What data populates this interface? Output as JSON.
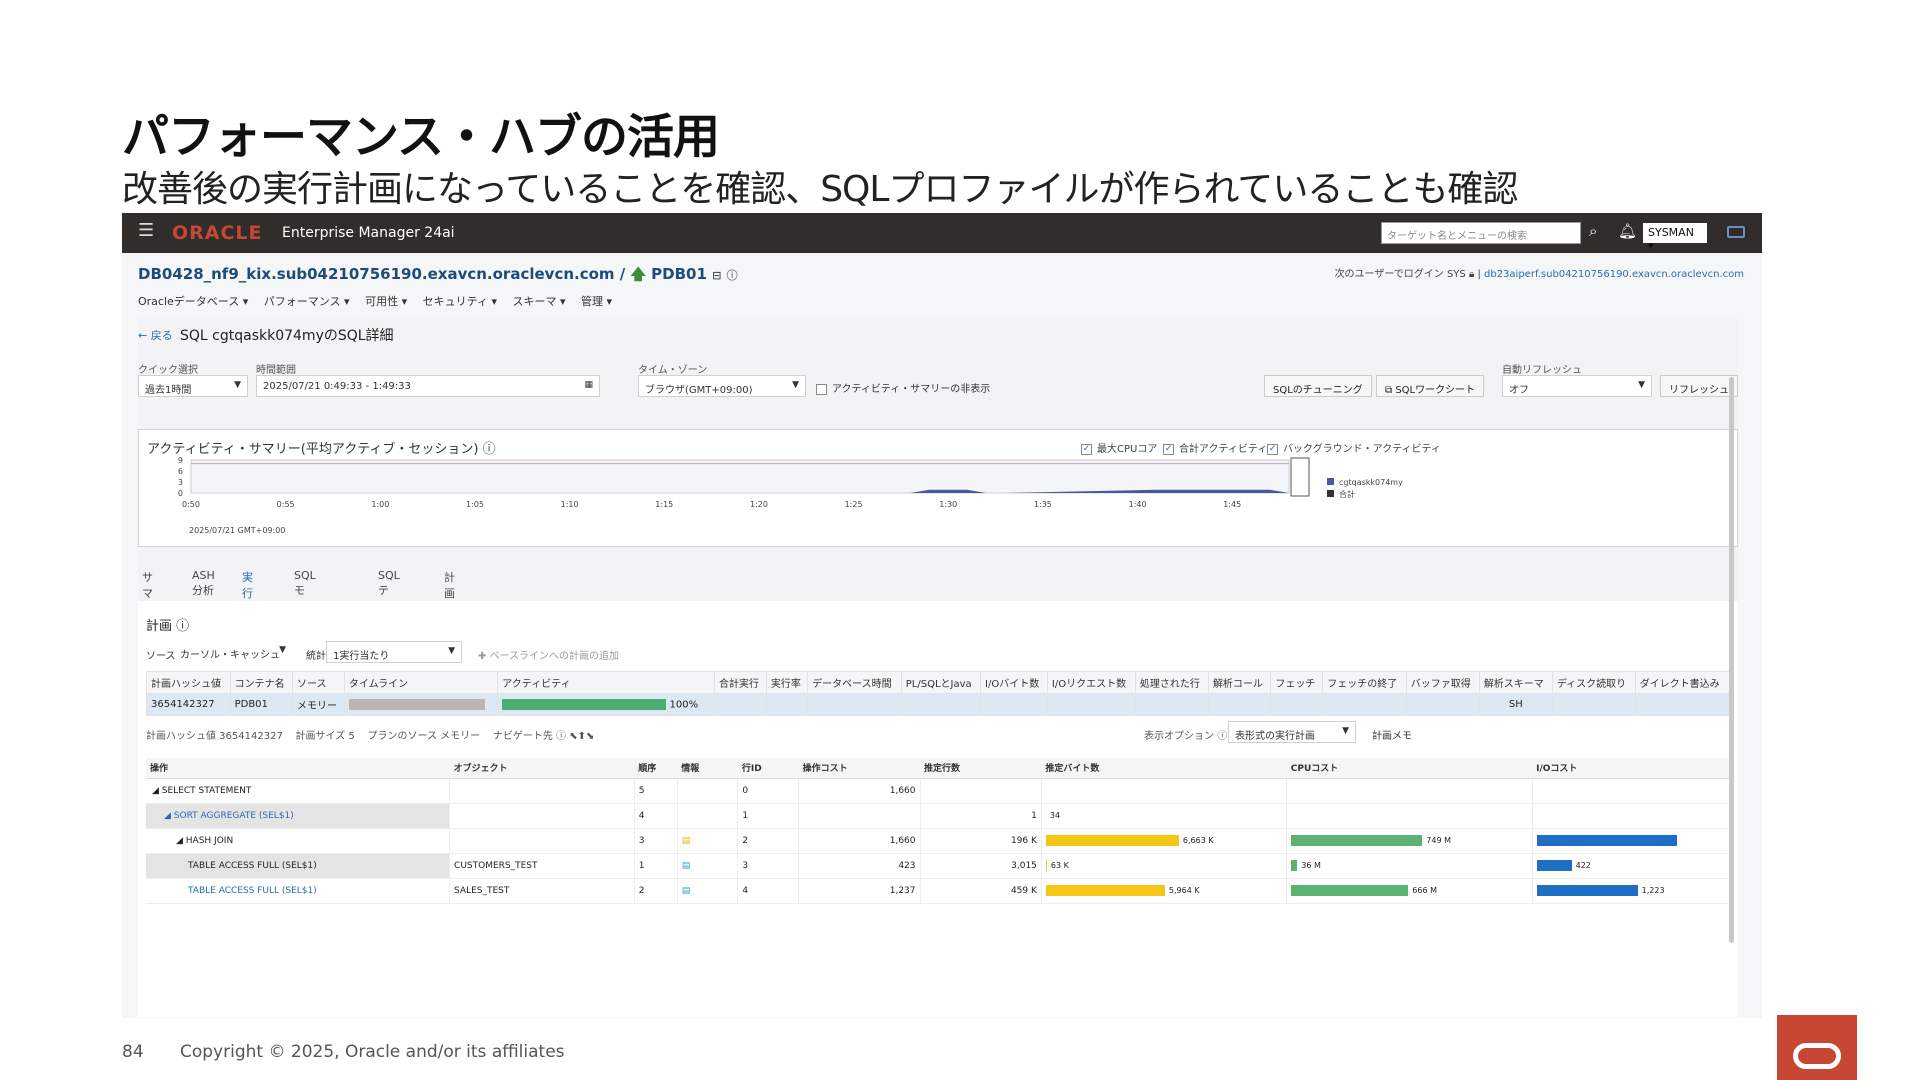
{
  "slide": {
    "title": "パフォーマンス・ハブの活用",
    "subtitle": "改善後の実行計画になっていることを確認、SQLプロファイルが作られていることも確認",
    "page_number": "84",
    "copyright": "Copyright © 2025, Oracle and/or its affiliates"
  },
  "topbar": {
    "brand": "ORACLE",
    "product": "Enterprise Manager 24ai",
    "search_placeholder": "ターゲット名とメニューの検索",
    "user": "SYSMAN"
  },
  "breadcrumb": {
    "db": "DB0428_nf9_kix.sub04210756190.exavcn.oraclevcn.com /",
    "pdb": "PDB01"
  },
  "login": {
    "text": "次のユーザーでログイン SYS",
    "host": "db23aiperf.sub04210756190.exavcn.oraclevcn.com"
  },
  "menu": [
    "Oracleデータベース ▾",
    "パフォーマンス ▾",
    "可用性 ▾",
    "セキュリティ ▾",
    "スキーマ ▾",
    "管理 ▾"
  ],
  "sql_detail": {
    "back": "← 戻る",
    "header": "SQL cgtqaskk074myのSQL詳細",
    "quick_select_label": "クイック選択",
    "quick_select_value": "過去1時間",
    "time_range_label": "時間範囲",
    "time_range_value": "2025/07/21 0:49:33 - 1:49:33",
    "timezone_label": "タイム・ゾーン",
    "timezone_value": "ブラウザ(GMT+09:00)",
    "hide_summary": "アクティビティ・サマリーの非表示",
    "sql_tuning": "SQLのチューニング",
    "sql_worksheet": "SQLワークシート",
    "auto_refresh_label": "自動リフレッシュ",
    "auto_refresh_value": "オフ",
    "refresh": "リフレッシュ"
  },
  "activity": {
    "title": "アクティビティ・サマリー(平均アクティブ・セッション)",
    "check_max_cpu": "最大CPUコア",
    "check_total": "合計アクティビティ",
    "check_background": "バックグラウンド・アクティビティ",
    "date_label": "2025/07/21 GMT+09:00"
  },
  "chart_data": {
    "type": "area",
    "title": "アクティビティ・サマリー(平均アクティブ・セッション)",
    "x_ticks": [
      "0:50",
      "0:55",
      "1:00",
      "1:05",
      "1:10",
      "1:15",
      "1:20",
      "1:25",
      "1:30",
      "1:35",
      "1:40",
      "1:45"
    ],
    "y_ticks": [
      "9",
      "6",
      "3",
      "0"
    ],
    "ylim": [
      0,
      9
    ],
    "series": [
      {
        "name": "cgtqaskk074my",
        "color": "#4a5a9c",
        "x": [
          "0:50",
          "1:28",
          "1:29",
          "1:31",
          "1:32",
          "1:33",
          "1:41",
          "1:42",
          "1:47",
          "1:48"
        ],
        "values": [
          0,
          0,
          0.9,
          0.9,
          0,
          0,
          0.9,
          0.9,
          0.9,
          0
        ]
      },
      {
        "name": "合計",
        "color": "#333333",
        "x": [
          "0:50",
          "1:48"
        ],
        "values": [
          0,
          0
        ]
      }
    ],
    "max_cpu_line": 8,
    "legend_position": "right"
  },
  "tabs": [
    "サマリー",
    "ASH分析",
    "実行統計",
    "SQLモニタリング",
    "SQLテキスト",
    "計画管理"
  ],
  "plan": {
    "title": "計画",
    "source_label": "ソース",
    "source_value": "カーソル・キャッシュ",
    "stat_label": "統計",
    "stat_value": "1実行当たり",
    "add_baseline": "ベースラインへの計画の追加",
    "metrics_headers": [
      "計画ハッシュ値",
      "コンテナ名",
      "ソース",
      "タイムライン",
      "アクティビティ",
      "合計実行",
      "実行率",
      "データベース時間",
      "PL/SQLとJava",
      "I/Oバイト数",
      "I/Oリクエスト数",
      "処理された行",
      "解析コール",
      "フェッチ",
      "フェッチの終了",
      "バッファ取得",
      "解析スキーマ",
      "ディスク読取り",
      "ダイレクト書込み"
    ],
    "metrics_row": {
      "hash": "3654142327",
      "container": "PDB01",
      "source": "メモリー",
      "activity_pct": 100,
      "activity_label": "100%",
      "schema": "SH"
    },
    "info_bar": {
      "hash": "計画ハッシュ値 3654142327",
      "size": "計画サイズ 5",
      "source": "プランのソース メモリー",
      "navigate": "ナビゲート先",
      "display_label": "表示オプション",
      "display_value": "表形式の実行計画",
      "memo": "計画メモ"
    },
    "plan_headers": [
      "操作",
      "オブジェクト",
      "順序",
      "情報",
      "行ID",
      "操作コスト",
      "推定行数",
      "推定バイト数",
      "CPUコスト",
      "I/Oコスト"
    ],
    "plan_rows": [
      {
        "op": "◢ SELECT STATEMENT",
        "obj": "",
        "order": "5",
        "rowid": "0",
        "cost": "1,660",
        "rows": "",
        "bytes": "",
        "bytes_val": 0,
        "cpu": "",
        "cpu_val": 0,
        "io": "",
        "io_val": 0,
        "link": false,
        "indent": 0
      },
      {
        "op": "◢ SORT AGGREGATE (SEL$1)",
        "obj": "",
        "order": "4",
        "rowid": "1",
        "cost": "",
        "rows": "1",
        "bytes": "34",
        "bytes_val": 0,
        "cpu": "",
        "cpu_val": 0,
        "io": "",
        "io_val": 0,
        "link": true,
        "indent": 1
      },
      {
        "op": "◢ HASH JOIN",
        "obj": "",
        "order": "3",
        "rowid": "2",
        "cost": "1,660",
        "rows": "196 K",
        "bytes": "6,663 K",
        "bytes_val": 6663,
        "cpu": "749 M",
        "cpu_val": 749,
        "io": "",
        "io_val": 1700,
        "link": false,
        "indent": 2
      },
      {
        "op": "TABLE ACCESS FULL (SEL$1)",
        "obj": "CUSTOMERS_TEST",
        "order": "1",
        "rowid": "3",
        "cost": "423",
        "rows": "3,015",
        "bytes": "63 K",
        "bytes_val": 63,
        "cpu": "36 M",
        "cpu_val": 36,
        "io": "422",
        "io_val": 422,
        "link": false,
        "indent": 3
      },
      {
        "op": "TABLE ACCESS FULL (SEL$1)",
        "obj": "SALES_TEST",
        "order": "2",
        "rowid": "4",
        "cost": "1,237",
        "rows": "459 K",
        "bytes": "5,964 K",
        "bytes_val": 5964,
        "cpu": "666 M",
        "cpu_val": 666,
        "io": "1,223",
        "io_val": 1223,
        "link": true,
        "indent": 3
      }
    ]
  },
  "colors": {
    "oracle_red": "#c74634",
    "bytes_bar": "#f5c518",
    "cpu_bar": "#5cb270",
    "io_bar": "#1e6fc4",
    "activity_bar": "#4cae6e",
    "timeline_bar": "#bdb4b4"
  }
}
